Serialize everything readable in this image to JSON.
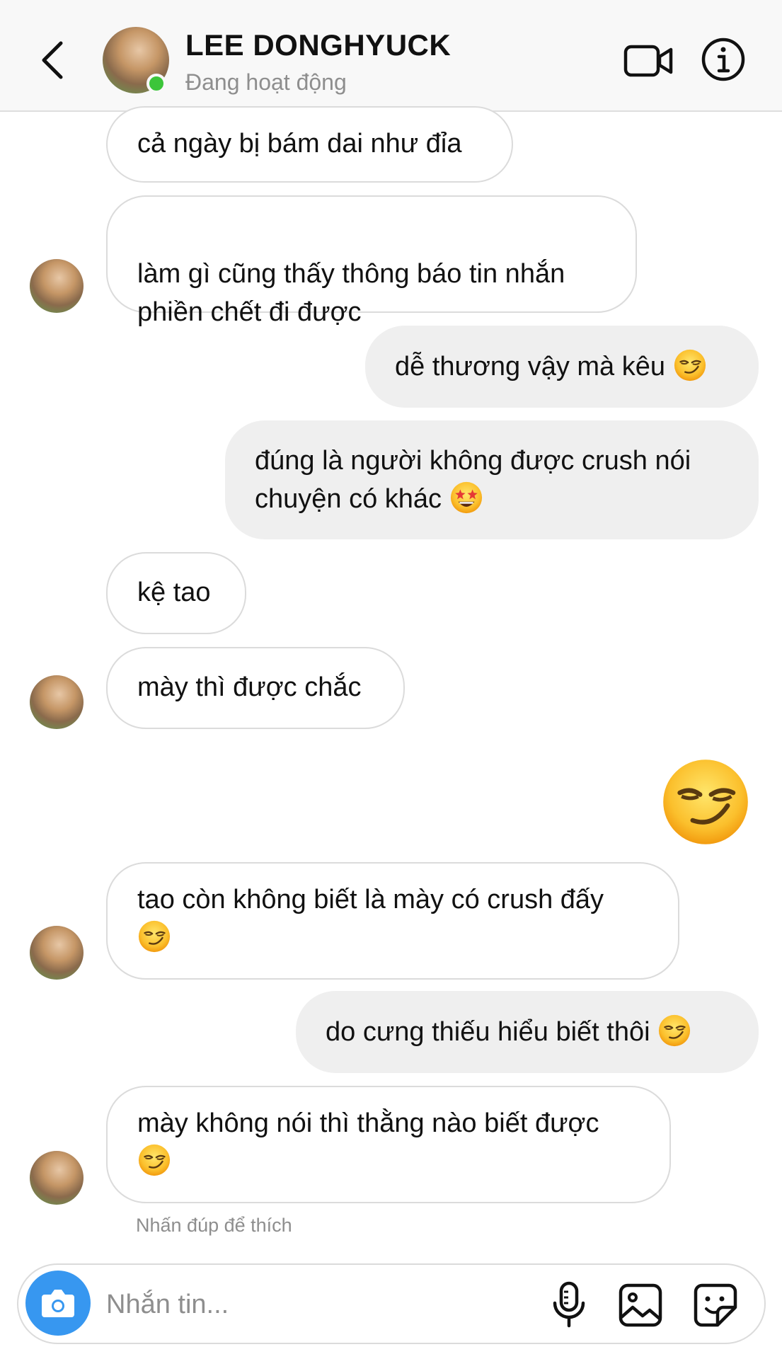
{
  "header": {
    "contact_name": "LEE DONGHYUCK",
    "status": "Đang hoạt động",
    "icons": [
      "back-icon",
      "video-call-icon",
      "info-icon"
    ]
  },
  "messages": [
    {
      "side": "in",
      "text": "cả ngày bị bám dai như đỉa",
      "emoji": ""
    },
    {
      "side": "in",
      "text": "làm gì cũng thấy thông báo tin nhắn\nphiền chết đi được",
      "emoji": ""
    },
    {
      "side": "out",
      "text": "dễ thương vậy mà kêu",
      "emoji": "smirk"
    },
    {
      "side": "out",
      "text": "đúng là người không được crush nói\nchuyện có khác",
      "emoji": "star-struck"
    },
    {
      "side": "in",
      "text": "kệ tao",
      "emoji": ""
    },
    {
      "side": "in",
      "text": "mày thì được chắc",
      "emoji": ""
    },
    {
      "side": "out",
      "text": "",
      "emoji": "smirk-large"
    },
    {
      "side": "in",
      "text": "tao còn không biết là mày có crush đấy",
      "emoji": "smirk"
    },
    {
      "side": "out",
      "text": "do cưng thiếu hiểu biết thôi",
      "emoji": "smirk"
    },
    {
      "side": "in",
      "text": "mày không nói thì thằng nào biết được",
      "emoji": "smirk"
    }
  ],
  "hint": "Nhấn đúp để thích",
  "composer": {
    "placeholder": "Nhắn tin...",
    "icons": [
      "camera-icon",
      "microphone-icon",
      "gallery-icon",
      "sticker-icon"
    ]
  },
  "colors": {
    "online": "#3cc53a",
    "camera_button": "#3797f0",
    "outgoing_bubble": "#efefef",
    "incoming_border": "#dbdbdb",
    "muted_text": "#8e8e8e"
  }
}
